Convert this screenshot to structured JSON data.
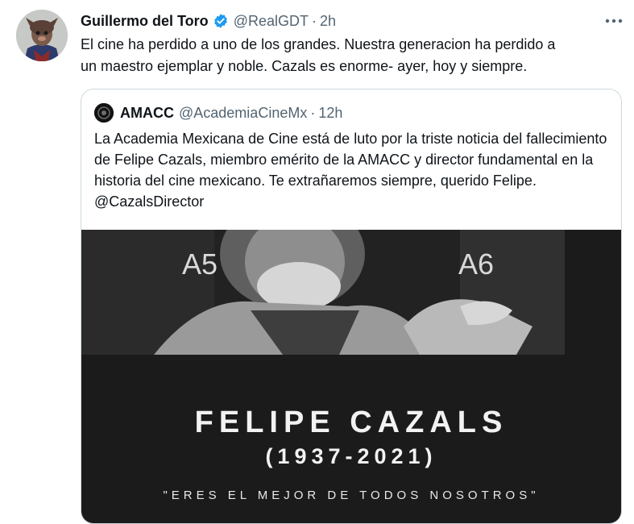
{
  "tweet": {
    "author_name": "Guillermo del Toro",
    "author_handle": "@RealGDT",
    "separator": "·",
    "time": "2h",
    "text_line1": "El cine ha perdido a uno de los grandes.  Nuestra generacion ha perdido a",
    "text_line2": "un maestro ejemplar y noble.  Cazals es enorme- ayer, hoy y siempre.",
    "verified_icon": "verified-badge-icon",
    "more_icon": "more-options-icon"
  },
  "quoted": {
    "author_name": "AMACC",
    "author_handle": "@AcademiaCineMx",
    "separator": "·",
    "time": "12h",
    "text": "La Academia Mexicana de Cine está de luto por la triste noticia del fallecimiento de Felipe Cazals, miembro emérito de la AMACC y director fundamental en la historia del cine mexicano. Te extrañaremos siempre, querido Felipe. @CazalsDirector"
  },
  "media": {
    "seat_left": "A5",
    "seat_right": "A6",
    "title": "FELIPE CAZALS",
    "years": "(1937-2021)",
    "quote": "\"ERES EL MEJOR DE TODOS NOSOTROS\""
  },
  "colors": {
    "verified": "#1d9bf0",
    "secondary_text": "#536471",
    "border": "#cfd9de"
  }
}
